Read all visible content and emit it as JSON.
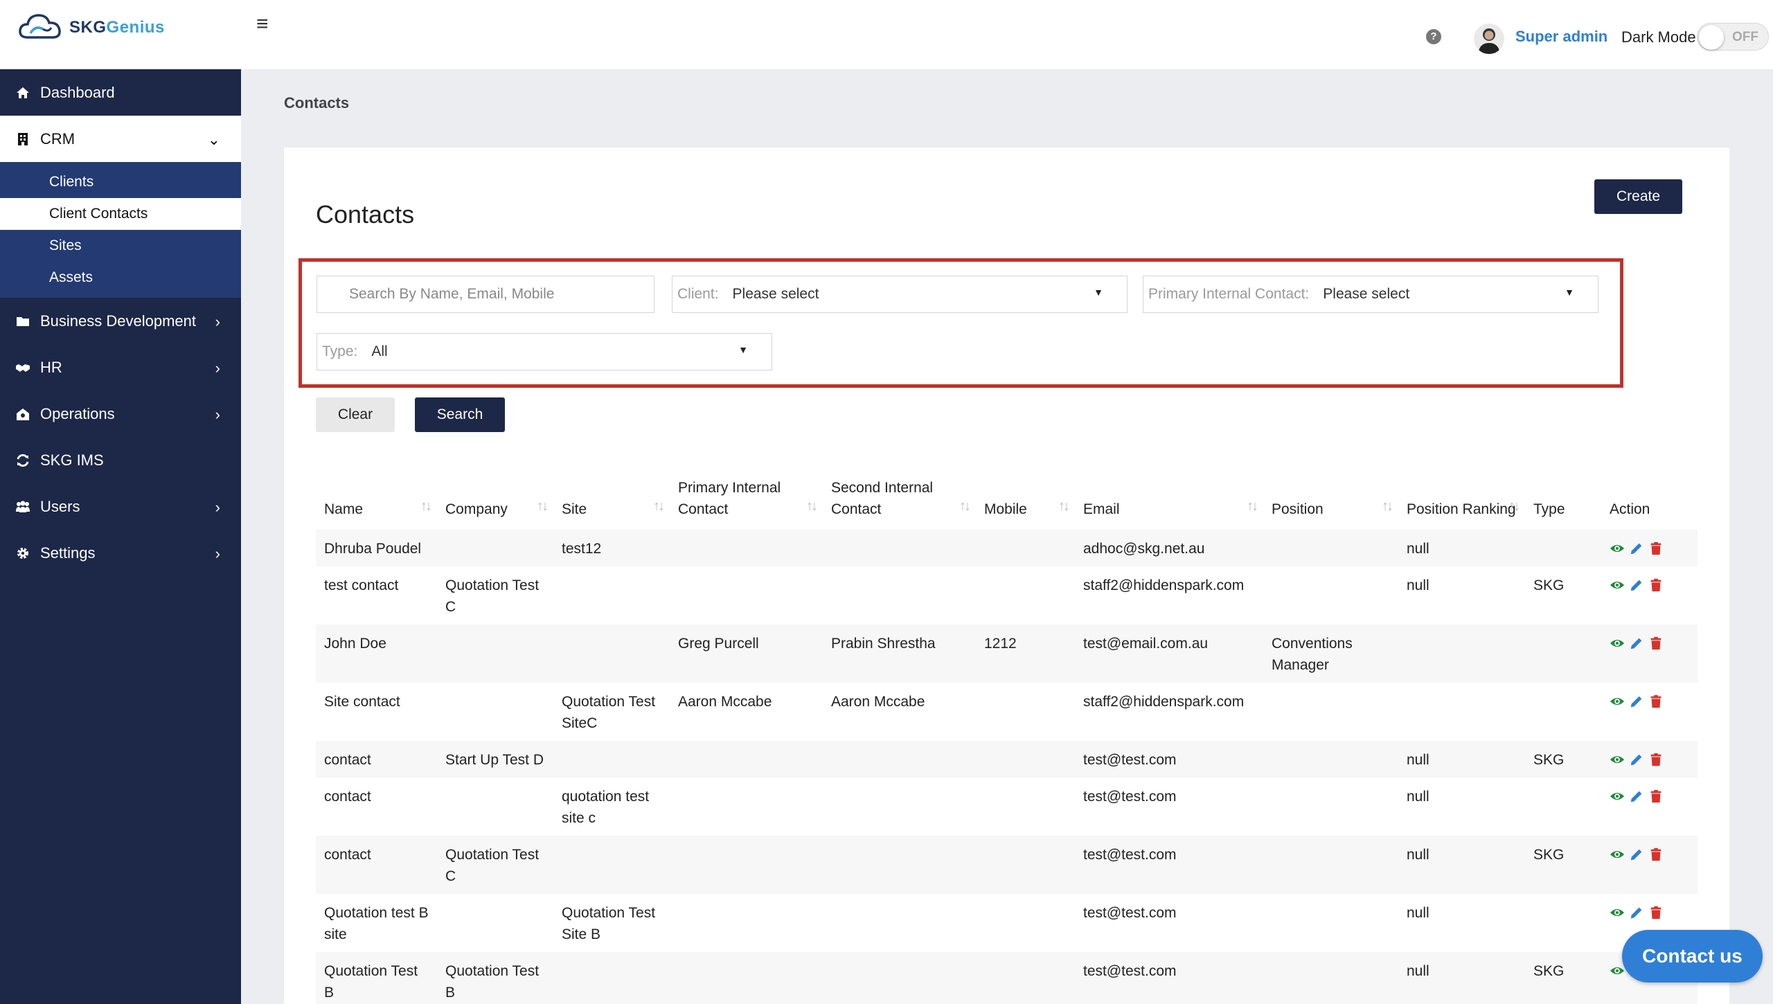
{
  "app": {
    "logo_brand": "SKG",
    "logo_accent": "enius"
  },
  "header": {
    "user_name": "Super admin",
    "dark_mode_label": "Dark Mode",
    "dark_mode_state": "OFF"
  },
  "sidebar": {
    "items": [
      {
        "label": "Dashboard"
      },
      {
        "label": "CRM"
      },
      {
        "label": "Business Development"
      },
      {
        "label": "HR"
      },
      {
        "label": "Operations"
      },
      {
        "label": "SKG IMS"
      },
      {
        "label": "Users"
      },
      {
        "label": "Settings"
      }
    ],
    "crm_sub": [
      {
        "label": "Clients"
      },
      {
        "label": "Client Contacts"
      },
      {
        "label": "Sites"
      },
      {
        "label": "Assets"
      }
    ]
  },
  "breadcrumb": "Contacts",
  "page_title": "Contacts",
  "create_label": "Create",
  "filters": {
    "search_placeholder": "Search By Name, Email, Mobile",
    "client_label": "Client:",
    "client_value": "Please select",
    "primary_label": "Primary Internal Contact:",
    "primary_value": "Please select",
    "type_label": "Type:",
    "type_value": "All"
  },
  "buttons": {
    "clear": "Clear",
    "search": "Search"
  },
  "table": {
    "columns": [
      "Name",
      "Company",
      "Site",
      "Primary Internal Contact",
      "Second Internal Contact",
      "Mobile",
      "Email",
      "Position",
      "Position Ranking",
      "Type",
      "Action"
    ],
    "rows": [
      {
        "name": "Dhruba Poudel",
        "company": "",
        "site": "test12",
        "primary": "",
        "second": "",
        "mobile": "",
        "email": "adhoc@skg.net.au",
        "position": "",
        "ranking": "null",
        "type": ""
      },
      {
        "name": "test contact",
        "company": "Quotation Test C",
        "site": "",
        "primary": "",
        "second": "",
        "mobile": "",
        "email": "staff2@hiddenspark.com",
        "position": "",
        "ranking": "null",
        "type": "SKG"
      },
      {
        "name": "John Doe",
        "company": "",
        "site": "",
        "primary": "Greg Purcell",
        "second": "Prabin Shrestha",
        "mobile": "1212",
        "email": "test@email.com.au",
        "position": "Conventions Manager",
        "ranking": "",
        "type": ""
      },
      {
        "name": "Site contact",
        "company": "",
        "site": "Quotation Test SiteC",
        "primary": "Aaron Mccabe",
        "second": "Aaron Mccabe",
        "mobile": "",
        "email": "staff2@hiddenspark.com",
        "position": "",
        "ranking": "",
        "type": ""
      },
      {
        "name": "contact",
        "company": "Start Up Test D",
        "site": "",
        "primary": "",
        "second": "",
        "mobile": "",
        "email": "test@test.com",
        "position": "",
        "ranking": "null",
        "type": "SKG"
      },
      {
        "name": "contact",
        "company": "",
        "site": "quotation test site c",
        "primary": "",
        "second": "",
        "mobile": "",
        "email": "test@test.com",
        "position": "",
        "ranking": "null",
        "type": ""
      },
      {
        "name": "contact",
        "company": "Quotation Test C",
        "site": "",
        "primary": "",
        "second": "",
        "mobile": "",
        "email": "test@test.com",
        "position": "",
        "ranking": "null",
        "type": "SKG"
      },
      {
        "name": "Quotation test B site",
        "company": "",
        "site": "Quotation Test Site B",
        "primary": "",
        "second": "",
        "mobile": "",
        "email": "test@test.com",
        "position": "",
        "ranking": "null",
        "type": ""
      },
      {
        "name": "Quotation Test B",
        "company": "Quotation Test B",
        "site": "",
        "primary": "",
        "second": "",
        "mobile": "",
        "email": "test@test.com",
        "position": "",
        "ranking": "null",
        "type": "SKG"
      }
    ]
  },
  "contact_us": "Contact us",
  "colors": {
    "sidebar_bg": "#1d2747",
    "submenu_bg": "#233a72",
    "accent_blue": "#2f7fd6",
    "filter_border": "#c0312b",
    "view_icon": "#1f8a3b",
    "edit_icon": "#2f7fd6",
    "delete_icon": "#d9312b"
  }
}
